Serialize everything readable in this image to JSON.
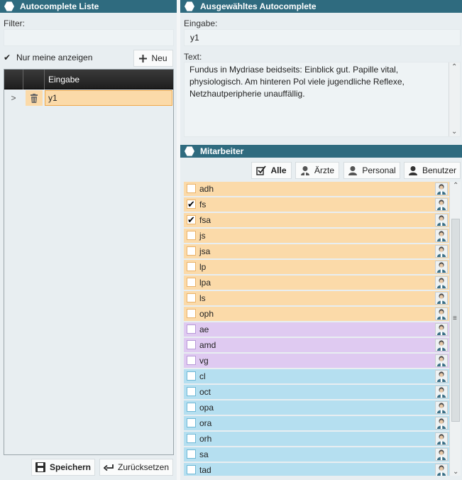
{
  "left": {
    "title": "Autocomplete Liste",
    "filter_label": "Filter:",
    "filter_value": "",
    "only_mine_label": "Nur meine anzeigen",
    "only_mine_checked": "✔",
    "new_button": "Neu",
    "grid": {
      "column": "Eingabe",
      "rows": [
        {
          "expander": ">",
          "value": "y1"
        }
      ]
    },
    "save_button": "Speichern",
    "reset_button": "Zurücksetzen"
  },
  "right": {
    "title": "Ausgewähltes Autocomplete",
    "input_label": "Eingabe:",
    "input_value": "y1",
    "text_label": "Text:",
    "text_value": "Fundus in Mydriase beidseits: Einblick gut. Papille vital, physiologisch. Am hinteren Pol viele jugendliche Reflexe, Netzhautperipherie unauffällig."
  },
  "staff": {
    "title": "Mitarbeiter",
    "filters": {
      "all": "Alle",
      "doctors": "Ärzte",
      "personnel": "Personal",
      "users": "Benutzer"
    },
    "colors": {
      "doctor": "#fbdaa9",
      "personnel": "#dfcaf1",
      "user": "#b5dff0"
    },
    "rows": [
      {
        "name": "adh",
        "checked": "",
        "group": "doctor"
      },
      {
        "name": "fs",
        "checked": "✔",
        "group": "doctor"
      },
      {
        "name": "fsa",
        "checked": "✔",
        "group": "doctor"
      },
      {
        "name": "js",
        "checked": "",
        "group": "doctor"
      },
      {
        "name": "jsa",
        "checked": "",
        "group": "doctor"
      },
      {
        "name": "lp",
        "checked": "",
        "group": "doctor"
      },
      {
        "name": "lpa",
        "checked": "",
        "group": "doctor"
      },
      {
        "name": "ls",
        "checked": "",
        "group": "doctor"
      },
      {
        "name": "oph",
        "checked": "",
        "group": "doctor"
      },
      {
        "name": "ae",
        "checked": "",
        "group": "personnel"
      },
      {
        "name": "amd",
        "checked": "",
        "group": "personnel"
      },
      {
        "name": "vg",
        "checked": "",
        "group": "personnel"
      },
      {
        "name": "cl",
        "checked": "",
        "group": "user"
      },
      {
        "name": "oct",
        "checked": "",
        "group": "user"
      },
      {
        "name": "opa",
        "checked": "",
        "group": "user"
      },
      {
        "name": "ora",
        "checked": "",
        "group": "user"
      },
      {
        "name": "orh",
        "checked": "",
        "group": "user"
      },
      {
        "name": "sa",
        "checked": "",
        "group": "user"
      },
      {
        "name": "tad",
        "checked": "",
        "group": "user"
      }
    ]
  }
}
